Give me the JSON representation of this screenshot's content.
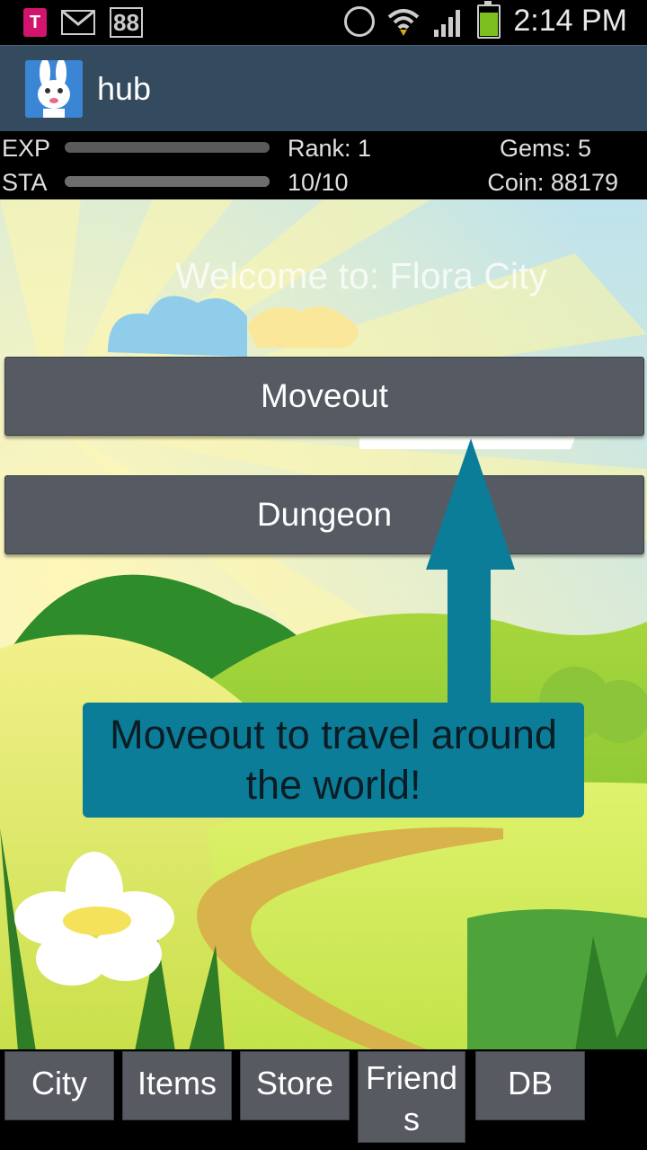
{
  "status_bar": {
    "icons_left": [
      "tmobile-icon",
      "mail-icon",
      "notification-88-icon"
    ],
    "badge": "88",
    "tmobile_letter": "T",
    "icons_right": [
      "alarm-icon",
      "wifi-icon",
      "signal-icon",
      "battery-icon"
    ],
    "time": "2:14 PM"
  },
  "action_bar": {
    "title": "hub",
    "icon": "bunny-app-icon",
    "background": "#334a5f"
  },
  "stats": {
    "exp_label": "EXP",
    "exp_progress": 0,
    "rank": "Rank: 1",
    "gems": "Gems: 5",
    "sta_label": "STA",
    "sta_progress": 1.0,
    "stamina": "10/10",
    "coin": "Coin: 88179"
  },
  "main": {
    "welcome": "Welcome to: Flora City",
    "moveout_label": "Moveout",
    "dungeon_label": "Dungeon",
    "tooltip": "Moveout to travel around the world!",
    "tooltip_color": "#0b7d99"
  },
  "tabs": [
    {
      "label": "City"
    },
    {
      "label": "Items"
    },
    {
      "label": "Store"
    },
    {
      "label": "Friends",
      "display": "Friend\ns"
    },
    {
      "label": "DB"
    }
  ]
}
